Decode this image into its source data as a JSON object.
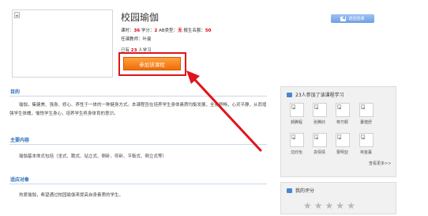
{
  "course": {
    "title": "校园瑜伽",
    "hours_label": "课时：",
    "hours": "36",
    "credit_label": "学分：",
    "credit": "2",
    "ab_label": "AB类型：",
    "ab": "无",
    "enroll_label": "报生名额：",
    "enroll": "50",
    "teacher": "任课教师：叶曼",
    "learners_prefix": "已有",
    "learners_count": "23",
    "learners_suffix": "人学习",
    "join_label": "参加该课程"
  },
  "back_button": {
    "label": "返回选课",
    "arrow": "◀"
  },
  "sections": [
    {
      "heading": "目的",
      "body": "瑜伽，集健美、强身、修心、养性于一体的一种健身方式。本课程旨在培养学生身体素质均衡发展，全身舒畅，心灵平静，从而增强学生体魄，愉悦学生身心，培养学生终身体育的意识。"
    },
    {
      "heading": "主要内容",
      "body": "瑜伽基本体式包括（坐式、跪式、站立式、倒卧、仰卧、平衡式、倒立式等）"
    },
    {
      "heading": "适应对象",
      "body": "热爱瑜伽，希望通过校园瑜伽来提高自身素质的学生。"
    }
  ],
  "participants": {
    "title": "23人参加了该课程学习",
    "names": [
      "郝腾程",
      "张腾欣",
      "蒋巧颖",
      "董楷舒",
      "沈欣怡",
      "袁倩倩",
      "曹明亚",
      "林金蔓"
    ],
    "more": "查看更多>>"
  },
  "rating": {
    "title": "我的评分",
    "stars": 5,
    "star_glyph": "★",
    "filled": 0
  },
  "colors": {
    "accent_blue": "#2b6fb9",
    "highlight_red": "#e0141b",
    "button_orange": "#f06d0a"
  }
}
